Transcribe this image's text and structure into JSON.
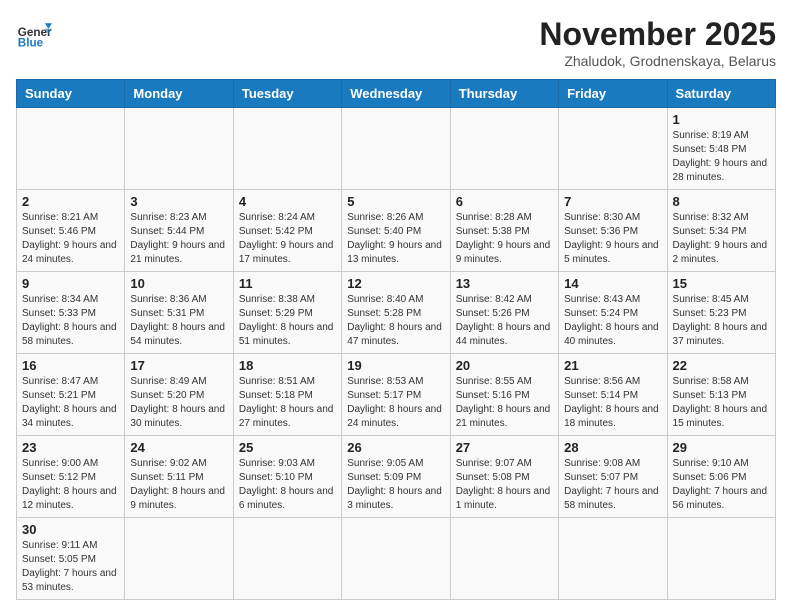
{
  "header": {
    "logo_general": "General",
    "logo_blue": "Blue",
    "month_title": "November 2025",
    "subtitle": "Zhaludok, Grodnenskaya, Belarus"
  },
  "weekdays": [
    "Sunday",
    "Monday",
    "Tuesday",
    "Wednesday",
    "Thursday",
    "Friday",
    "Saturday"
  ],
  "weeks": [
    [
      {
        "day": "",
        "info": ""
      },
      {
        "day": "",
        "info": ""
      },
      {
        "day": "",
        "info": ""
      },
      {
        "day": "",
        "info": ""
      },
      {
        "day": "",
        "info": ""
      },
      {
        "day": "",
        "info": ""
      },
      {
        "day": "1",
        "info": "Sunrise: 8:19 AM\nSunset: 5:48 PM\nDaylight: 9 hours\nand 28 minutes."
      }
    ],
    [
      {
        "day": "2",
        "info": "Sunrise: 8:21 AM\nSunset: 5:46 PM\nDaylight: 9 hours\nand 24 minutes."
      },
      {
        "day": "3",
        "info": "Sunrise: 8:23 AM\nSunset: 5:44 PM\nDaylight: 9 hours\nand 21 minutes."
      },
      {
        "day": "4",
        "info": "Sunrise: 8:24 AM\nSunset: 5:42 PM\nDaylight: 9 hours\nand 17 minutes."
      },
      {
        "day": "5",
        "info": "Sunrise: 8:26 AM\nSunset: 5:40 PM\nDaylight: 9 hours\nand 13 minutes."
      },
      {
        "day": "6",
        "info": "Sunrise: 8:28 AM\nSunset: 5:38 PM\nDaylight: 9 hours\nand 9 minutes."
      },
      {
        "day": "7",
        "info": "Sunrise: 8:30 AM\nSunset: 5:36 PM\nDaylight: 9 hours\nand 5 minutes."
      },
      {
        "day": "8",
        "info": "Sunrise: 8:32 AM\nSunset: 5:34 PM\nDaylight: 9 hours\nand 2 minutes."
      }
    ],
    [
      {
        "day": "9",
        "info": "Sunrise: 8:34 AM\nSunset: 5:33 PM\nDaylight: 8 hours\nand 58 minutes."
      },
      {
        "day": "10",
        "info": "Sunrise: 8:36 AM\nSunset: 5:31 PM\nDaylight: 8 hours\nand 54 minutes."
      },
      {
        "day": "11",
        "info": "Sunrise: 8:38 AM\nSunset: 5:29 PM\nDaylight: 8 hours\nand 51 minutes."
      },
      {
        "day": "12",
        "info": "Sunrise: 8:40 AM\nSunset: 5:28 PM\nDaylight: 8 hours\nand 47 minutes."
      },
      {
        "day": "13",
        "info": "Sunrise: 8:42 AM\nSunset: 5:26 PM\nDaylight: 8 hours\nand 44 minutes."
      },
      {
        "day": "14",
        "info": "Sunrise: 8:43 AM\nSunset: 5:24 PM\nDaylight: 8 hours\nand 40 minutes."
      },
      {
        "day": "15",
        "info": "Sunrise: 8:45 AM\nSunset: 5:23 PM\nDaylight: 8 hours\nand 37 minutes."
      }
    ],
    [
      {
        "day": "16",
        "info": "Sunrise: 8:47 AM\nSunset: 5:21 PM\nDaylight: 8 hours\nand 34 minutes."
      },
      {
        "day": "17",
        "info": "Sunrise: 8:49 AM\nSunset: 5:20 PM\nDaylight: 8 hours\nand 30 minutes."
      },
      {
        "day": "18",
        "info": "Sunrise: 8:51 AM\nSunset: 5:18 PM\nDaylight: 8 hours\nand 27 minutes."
      },
      {
        "day": "19",
        "info": "Sunrise: 8:53 AM\nSunset: 5:17 PM\nDaylight: 8 hours\nand 24 minutes."
      },
      {
        "day": "20",
        "info": "Sunrise: 8:55 AM\nSunset: 5:16 PM\nDaylight: 8 hours\nand 21 minutes."
      },
      {
        "day": "21",
        "info": "Sunrise: 8:56 AM\nSunset: 5:14 PM\nDaylight: 8 hours\nand 18 minutes."
      },
      {
        "day": "22",
        "info": "Sunrise: 8:58 AM\nSunset: 5:13 PM\nDaylight: 8 hours\nand 15 minutes."
      }
    ],
    [
      {
        "day": "23",
        "info": "Sunrise: 9:00 AM\nSunset: 5:12 PM\nDaylight: 8 hours\nand 12 minutes."
      },
      {
        "day": "24",
        "info": "Sunrise: 9:02 AM\nSunset: 5:11 PM\nDaylight: 8 hours\nand 9 minutes."
      },
      {
        "day": "25",
        "info": "Sunrise: 9:03 AM\nSunset: 5:10 PM\nDaylight: 8 hours\nand 6 minutes."
      },
      {
        "day": "26",
        "info": "Sunrise: 9:05 AM\nSunset: 5:09 PM\nDaylight: 8 hours\nand 3 minutes."
      },
      {
        "day": "27",
        "info": "Sunrise: 9:07 AM\nSunset: 5:08 PM\nDaylight: 8 hours\nand 1 minute."
      },
      {
        "day": "28",
        "info": "Sunrise: 9:08 AM\nSunset: 5:07 PM\nDaylight: 7 hours\nand 58 minutes."
      },
      {
        "day": "29",
        "info": "Sunrise: 9:10 AM\nSunset: 5:06 PM\nDaylight: 7 hours\nand 56 minutes."
      }
    ],
    [
      {
        "day": "30",
        "info": "Sunrise: 9:11 AM\nSunset: 5:05 PM\nDaylight: 7 hours\nand 53 minutes."
      },
      {
        "day": "",
        "info": ""
      },
      {
        "day": "",
        "info": ""
      },
      {
        "day": "",
        "info": ""
      },
      {
        "day": "",
        "info": ""
      },
      {
        "day": "",
        "info": ""
      },
      {
        "day": "",
        "info": ""
      }
    ]
  ]
}
